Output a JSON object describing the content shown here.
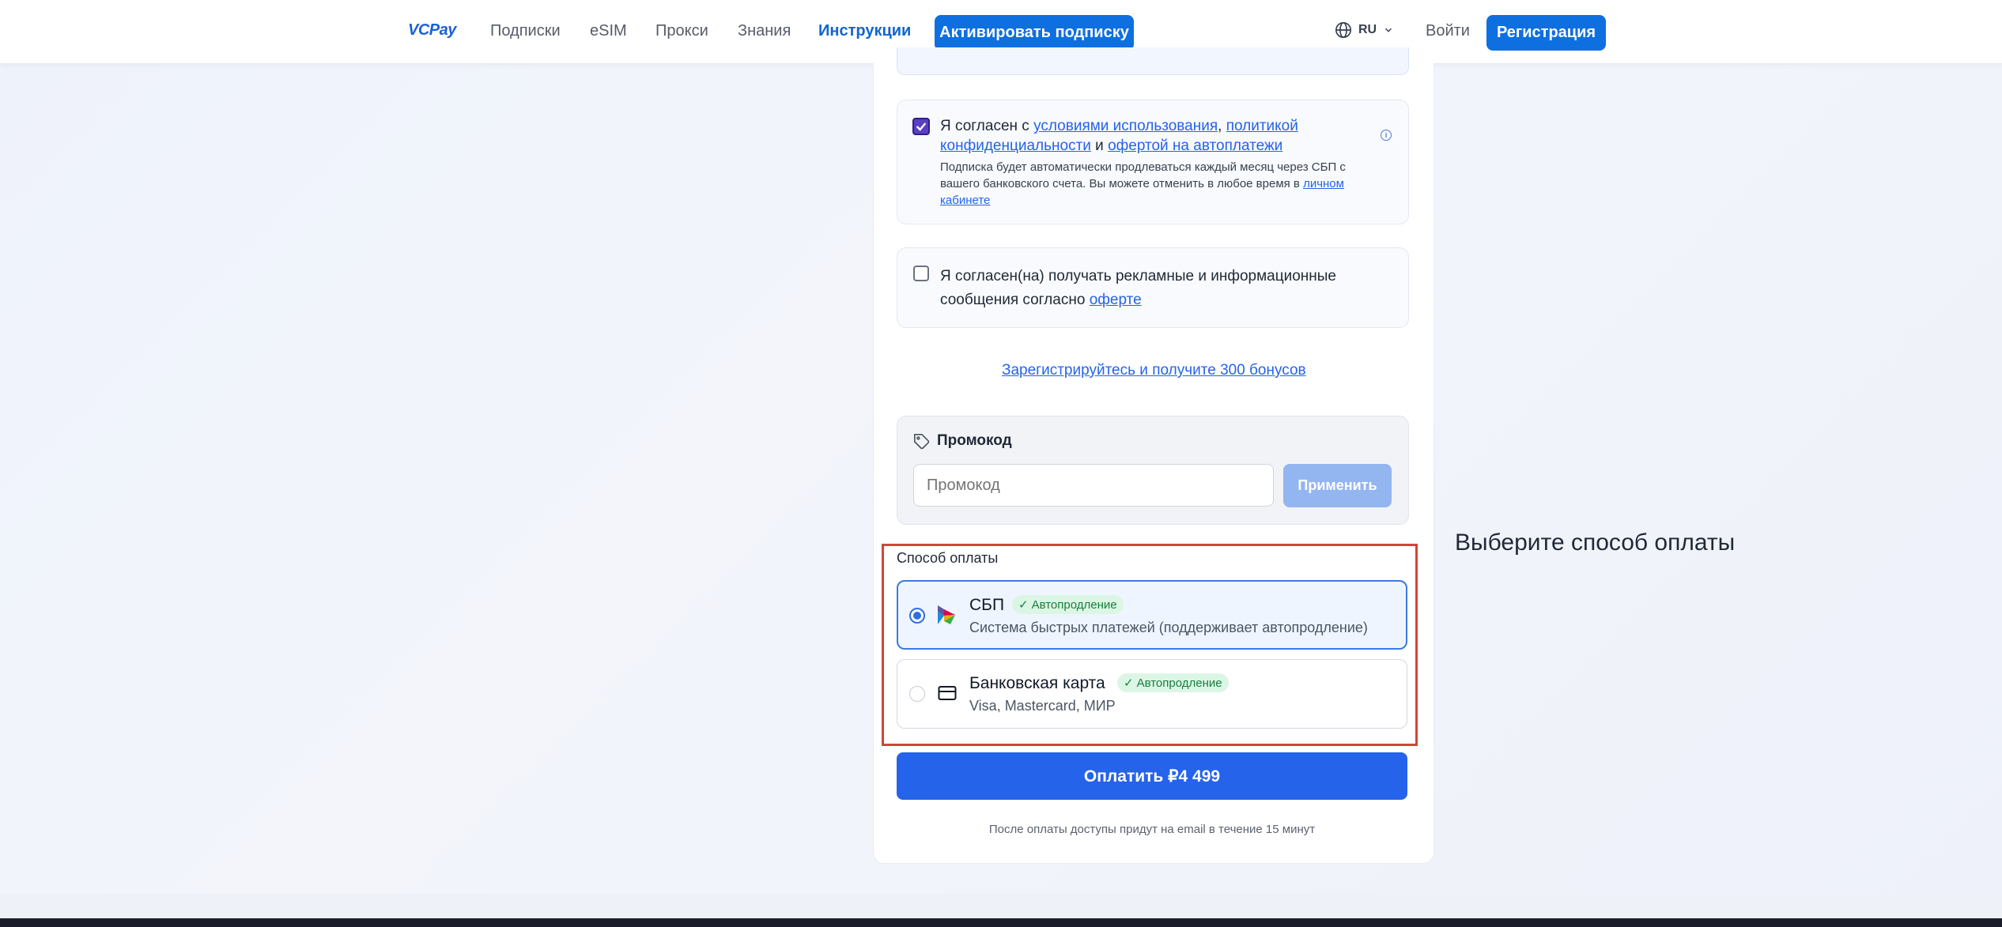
{
  "header": {
    "logo": "VCPay",
    "nav": [
      "Подписки",
      "eSIM",
      "Прокси",
      "Знания",
      "Инструкции"
    ],
    "activate_label": "Активировать подписку",
    "lang": "RU",
    "login": "Войти",
    "register": "Регистрация"
  },
  "agreements": {
    "terms_prefix": "Я согласен с ",
    "terms_link": "условиями использования",
    "comma": ",",
    "privacy_link": "политикой конфиденциальности",
    "and": " и ",
    "offer_link": "офертой на автоплатежи",
    "terms_checked": true,
    "note_text": "Подписка будет автоматически продлеваться каждый месяц через СБП с вашего банковского счета. Вы можете отменить в любое время в ",
    "note_link": "личном кабинете",
    "marketing_text": "Я согласен(на) получать рекламные и информационные сообщения согласно ",
    "marketing_link": "оферте",
    "marketing_checked": false
  },
  "bonus_link": "Зарегистрируйтесь и получите 300 бонусов",
  "promo": {
    "label": "Промокод",
    "placeholder": "Промокод",
    "apply": "Применить"
  },
  "payment": {
    "title": "Способ оплаты",
    "options": [
      {
        "name": "СБП",
        "badge": "Автопродление",
        "desc": "Система быстрых платежей (поддерживает автопродление)",
        "selected": true,
        "icon": "sbp-icon"
      },
      {
        "name": "Банковская карта",
        "badge": "Автопродление",
        "desc": "Visa, Mastercard, МИР",
        "selected": false,
        "icon": "credit-card-icon"
      }
    ],
    "pay_button": "Оплатить ₽4 499",
    "after_note": "После оплаты доступы придут на email в течение 15 минут"
  },
  "side_hint": "Выберите способ оплаты",
  "colors": {
    "primary": "#2563eb",
    "highlight_frame": "#d0453b",
    "badge_bg": "#dcf6e5"
  }
}
